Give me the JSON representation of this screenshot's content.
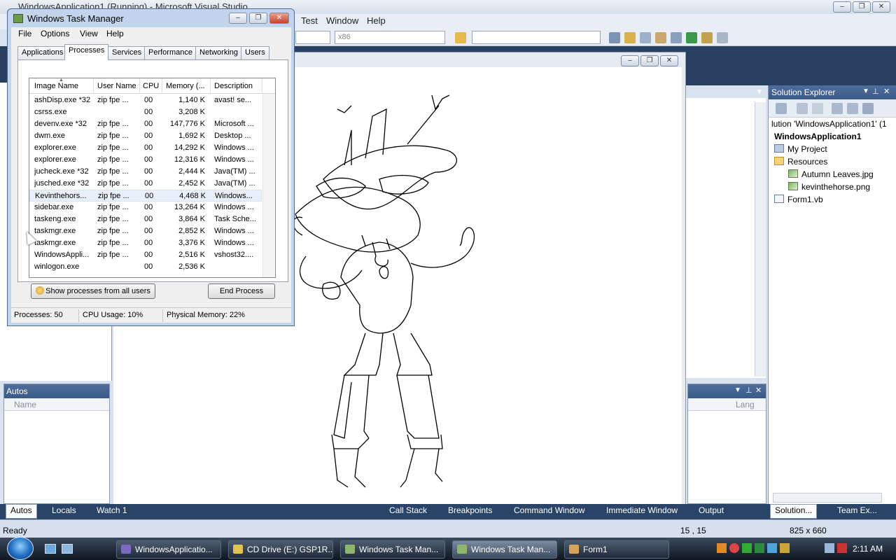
{
  "vs": {
    "title": "WindowsApplication1 (Running) - Microsoft Visual Studio",
    "menu": [
      "Test",
      "Window",
      "Help"
    ],
    "platform_combo": "x86",
    "solution_explorer": {
      "title": "Solution Explorer",
      "solution_label": "lution 'WindowsApplication1' (1",
      "project": "WindowsApplication1",
      "items": [
        "My Project",
        "Resources",
        "Autumn Leaves.jpg",
        "kevinthehorse.png",
        "Form1.vb"
      ]
    },
    "autos": {
      "title": "Autos",
      "col_name": "Name",
      "col_lang": "Lang"
    },
    "bottom_tabs_left": [
      "Autos",
      "Locals",
      "Watch 1"
    ],
    "bottom_tabs_right": [
      "Call Stack",
      "Breakpoints",
      "Command Window",
      "Immediate Window",
      "Output"
    ],
    "se_tabs": [
      "Solution...",
      "Team Ex..."
    ],
    "status": {
      "left": "Ready",
      "position": "15 , 15",
      "size": "825 x 660"
    }
  },
  "task_manager": {
    "title": "Windows Task Manager",
    "menu": [
      "File",
      "Options",
      "View",
      "Help"
    ],
    "tabs": [
      "Applications",
      "Processes",
      "Services",
      "Performance",
      "Networking",
      "Users"
    ],
    "active_tab": "Processes",
    "columns": [
      "Image Name",
      "User Name",
      "CPU",
      "Memory (...",
      "Description"
    ],
    "processes": [
      [
        "ashDisp.exe *32",
        "zip fpe ...",
        "00",
        "1,140 K",
        "avast! se..."
      ],
      [
        "csrss.exe",
        "",
        "00",
        "3,208 K",
        ""
      ],
      [
        "devenv.exe *32",
        "zip fpe ...",
        "00",
        "147,776 K",
        "Microsoft ..."
      ],
      [
        "dwm.exe",
        "zip fpe ...",
        "00",
        "1,692 K",
        "Desktop ..."
      ],
      [
        "explorer.exe",
        "zip fpe ...",
        "00",
        "14,292 K",
        "Windows ..."
      ],
      [
        "explorer.exe",
        "zip fpe ...",
        "00",
        "12,316 K",
        "Windows ..."
      ],
      [
        "jucheck.exe *32",
        "zip fpe ...",
        "00",
        "2,444 K",
        "Java(TM) ..."
      ],
      [
        "jusched.exe *32",
        "zip fpe ...",
        "00",
        "2,452 K",
        "Java(TM) ..."
      ],
      [
        "Kevinthehors...",
        "zip fpe ...",
        "00",
        "4,468 K",
        "Windows..."
      ],
      [
        "sidebar.exe",
        "zip fpe ...",
        "00",
        "13,264 K",
        "Windows ..."
      ],
      [
        "taskeng.exe",
        "zip fpe ...",
        "00",
        "3,864 K",
        "Task Sche..."
      ],
      [
        "taskmgr.exe",
        "zip fpe ...",
        "00",
        "2,852 K",
        "Windows ..."
      ],
      [
        "taskmgr.exe",
        "zip fpe ...",
        "00",
        "3,376 K",
        "Windows ..."
      ],
      [
        "WindowsAppli...",
        "zip fpe ...",
        "00",
        "2,516 K",
        "vshost32...."
      ],
      [
        "winlogon.exe",
        "",
        "00",
        "2,536 K",
        ""
      ]
    ],
    "selected_row": 8,
    "show_all_button": "Show processes from all users",
    "end_process_button": "End Process",
    "status": {
      "processes": "Processes: 50",
      "cpu": "CPU Usage: 10%",
      "memory": "Physical Memory: 22%"
    }
  },
  "taskbar": {
    "buttons": [
      "WindowsApplicatio...",
      "CD Drive (E:) GSP1R...",
      "Windows Task Man...",
      "Windows Task Man...",
      "Form1"
    ],
    "active_index": 3,
    "clock": "2:11 AM"
  }
}
